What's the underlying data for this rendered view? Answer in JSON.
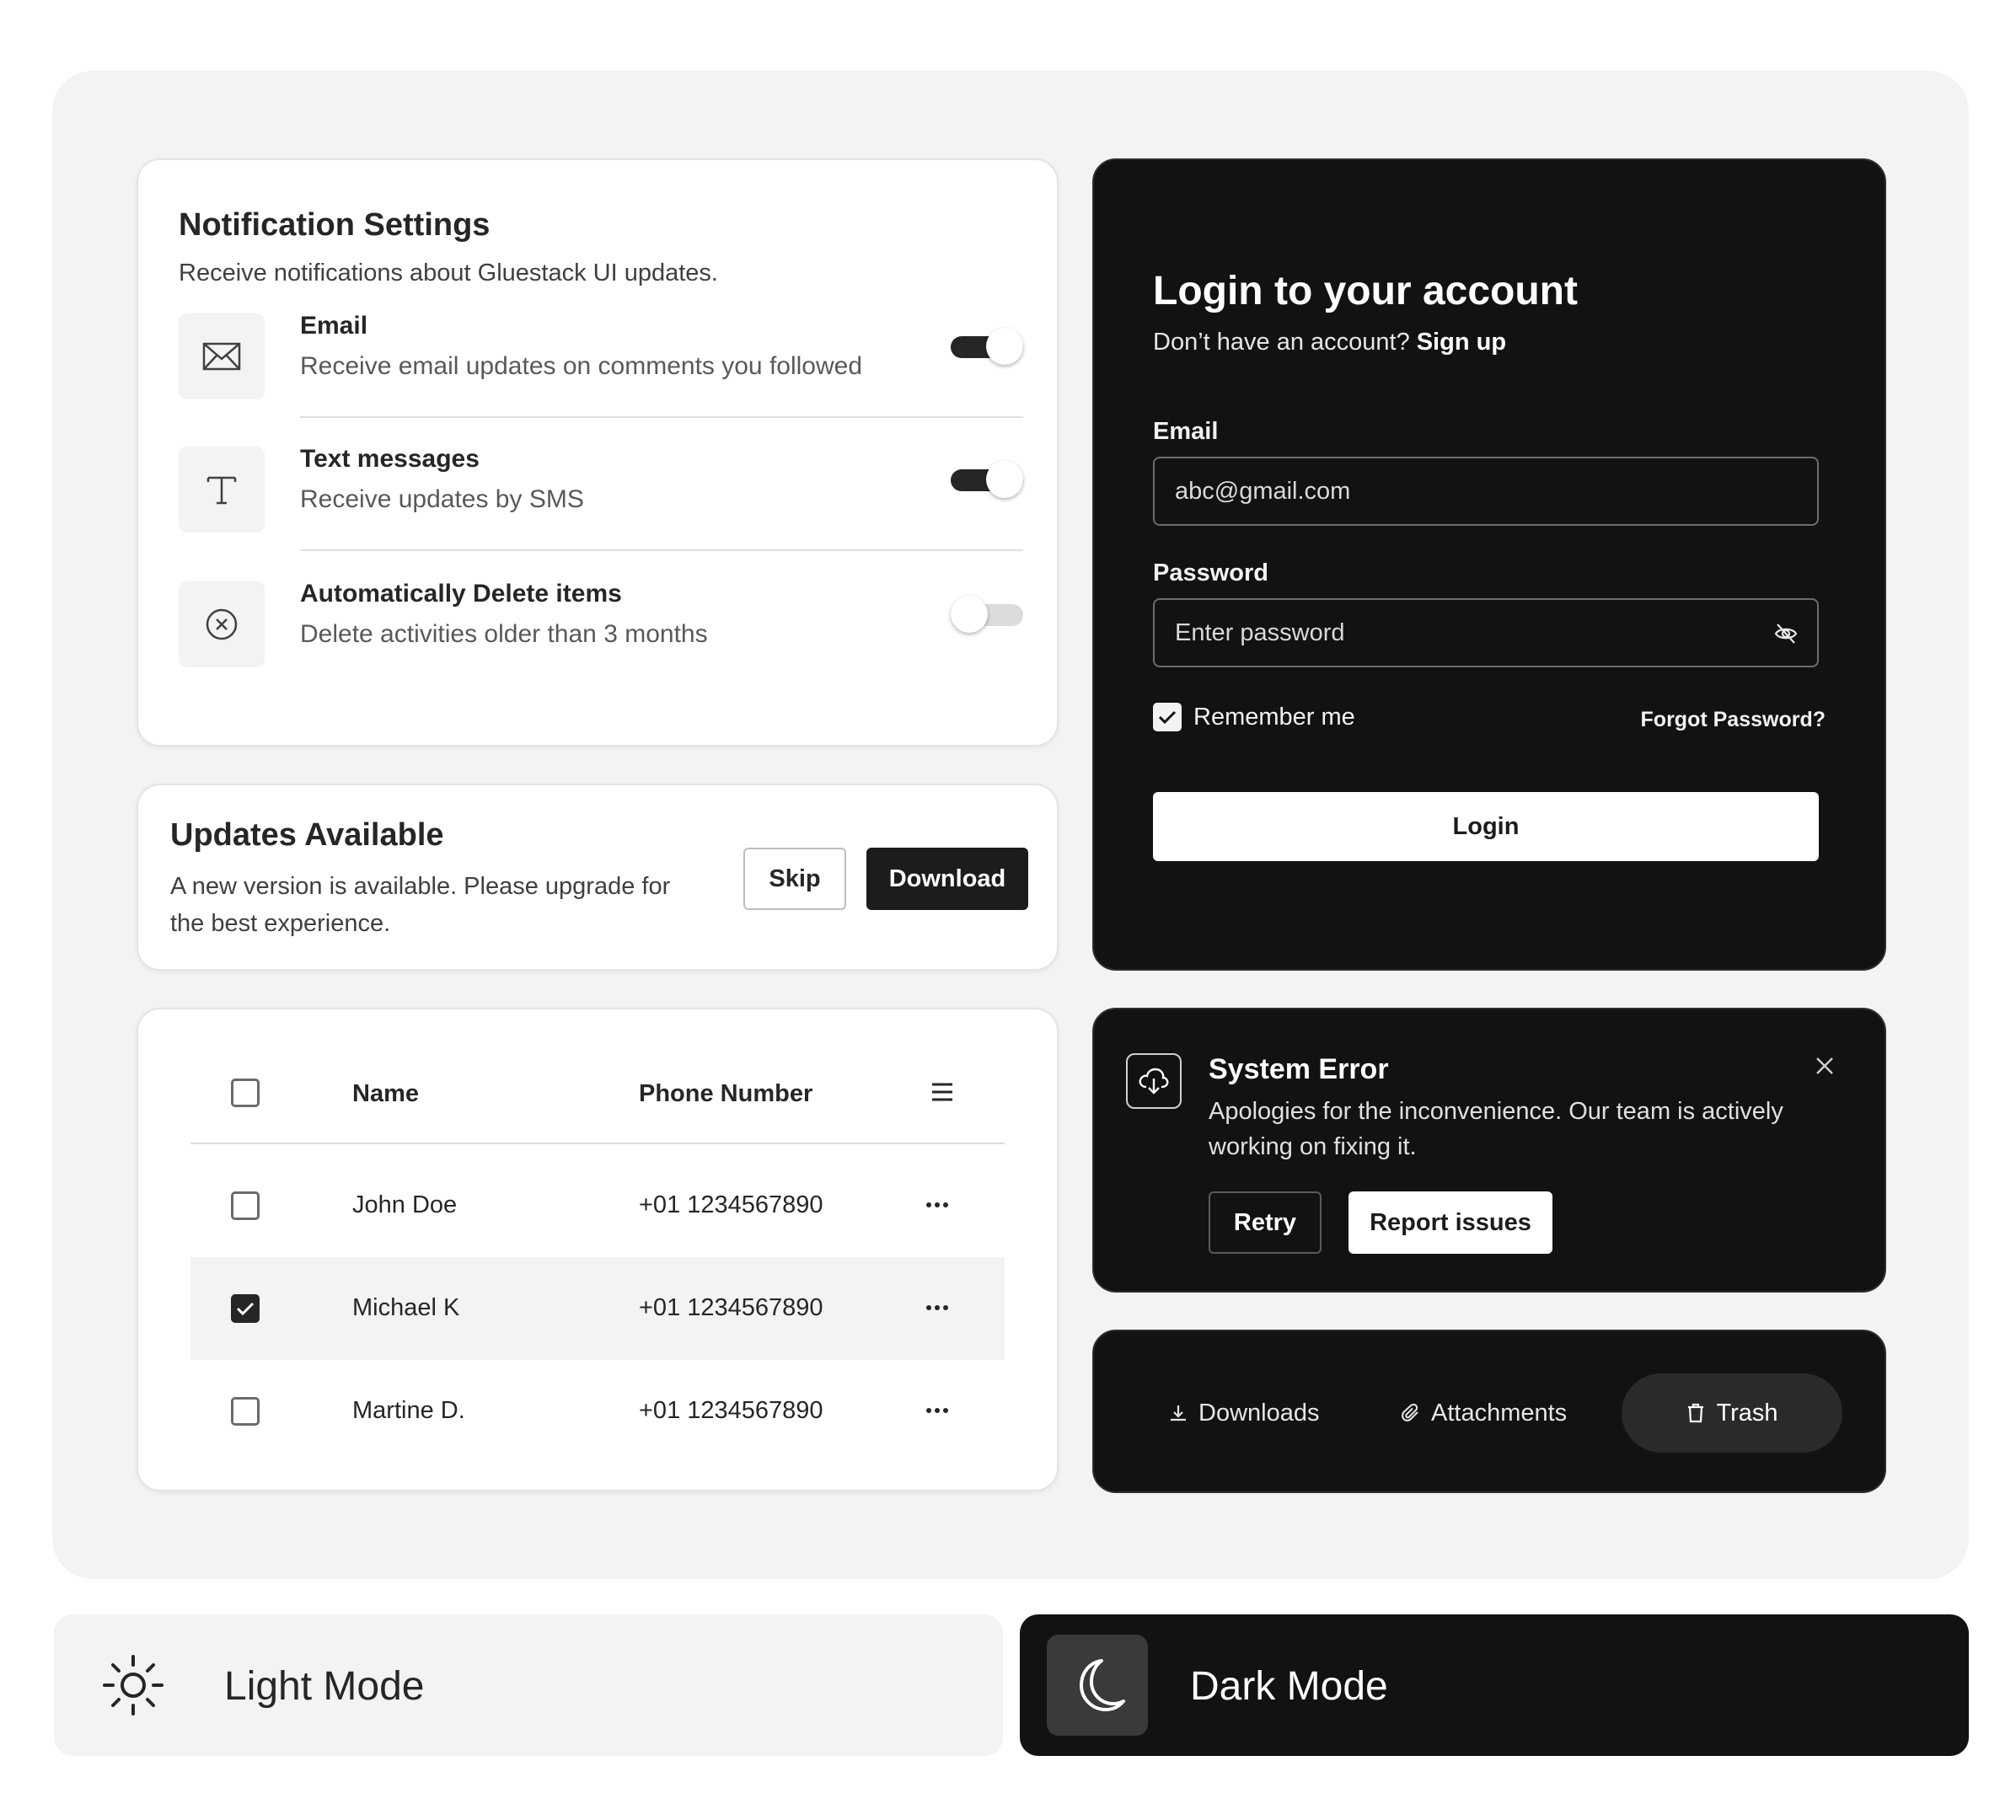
{
  "notification_settings": {
    "title": "Notification Settings",
    "subtitle": "Receive notifications about Gluestack UI updates.",
    "items": [
      {
        "label": "Email",
        "description": "Receive email updates on comments you followed",
        "icon": "mail-icon",
        "enabled": true
      },
      {
        "label": "Text messages",
        "description": "Receive updates by SMS",
        "icon": "text-icon",
        "enabled": true
      },
      {
        "label": "Automatically Delete items",
        "description": "Delete activities older than 3 months",
        "icon": "x-circle-icon",
        "enabled": false
      }
    ]
  },
  "updates": {
    "title": "Updates Available",
    "description": "A new version is available. Please upgrade for the best experience.",
    "skip_label": "Skip",
    "download_label": "Download"
  },
  "table": {
    "columns": [
      "Name",
      "Phone Number"
    ],
    "rows": [
      {
        "name": "John Doe",
        "phone": "+01 1234567890",
        "checked": false
      },
      {
        "name": "Michael K",
        "phone": "+01 1234567890",
        "checked": true
      },
      {
        "name": "Martine D.",
        "phone": "+01 1234567890",
        "checked": false
      }
    ]
  },
  "login": {
    "title": "Login to your account",
    "no_account": "Don’t have an account?",
    "signup": "Sign up",
    "email_label": "Email",
    "email_value": "abc@gmail.com",
    "password_label": "Password",
    "password_placeholder": "Enter password",
    "remember": "Remember me",
    "forgot": "Forgot Password?",
    "button": "Login"
  },
  "system_error": {
    "title": "System Error",
    "description": "Apologies for the inconvenience. Our team is actively working on fixing it.",
    "retry": "Retry",
    "report": "Report issues"
  },
  "tabs": {
    "items": [
      {
        "label": "Downloads",
        "icon": "download-icon"
      },
      {
        "label": "Attachments",
        "icon": "paperclip-icon"
      },
      {
        "label": "Trash",
        "icon": "trash-icon",
        "active": true
      }
    ]
  },
  "modes": {
    "light": "Light Mode",
    "dark": "Dark Mode"
  },
  "colors": {
    "dark": "#121212",
    "light": "#f3f3f3",
    "accent": "#262626"
  }
}
